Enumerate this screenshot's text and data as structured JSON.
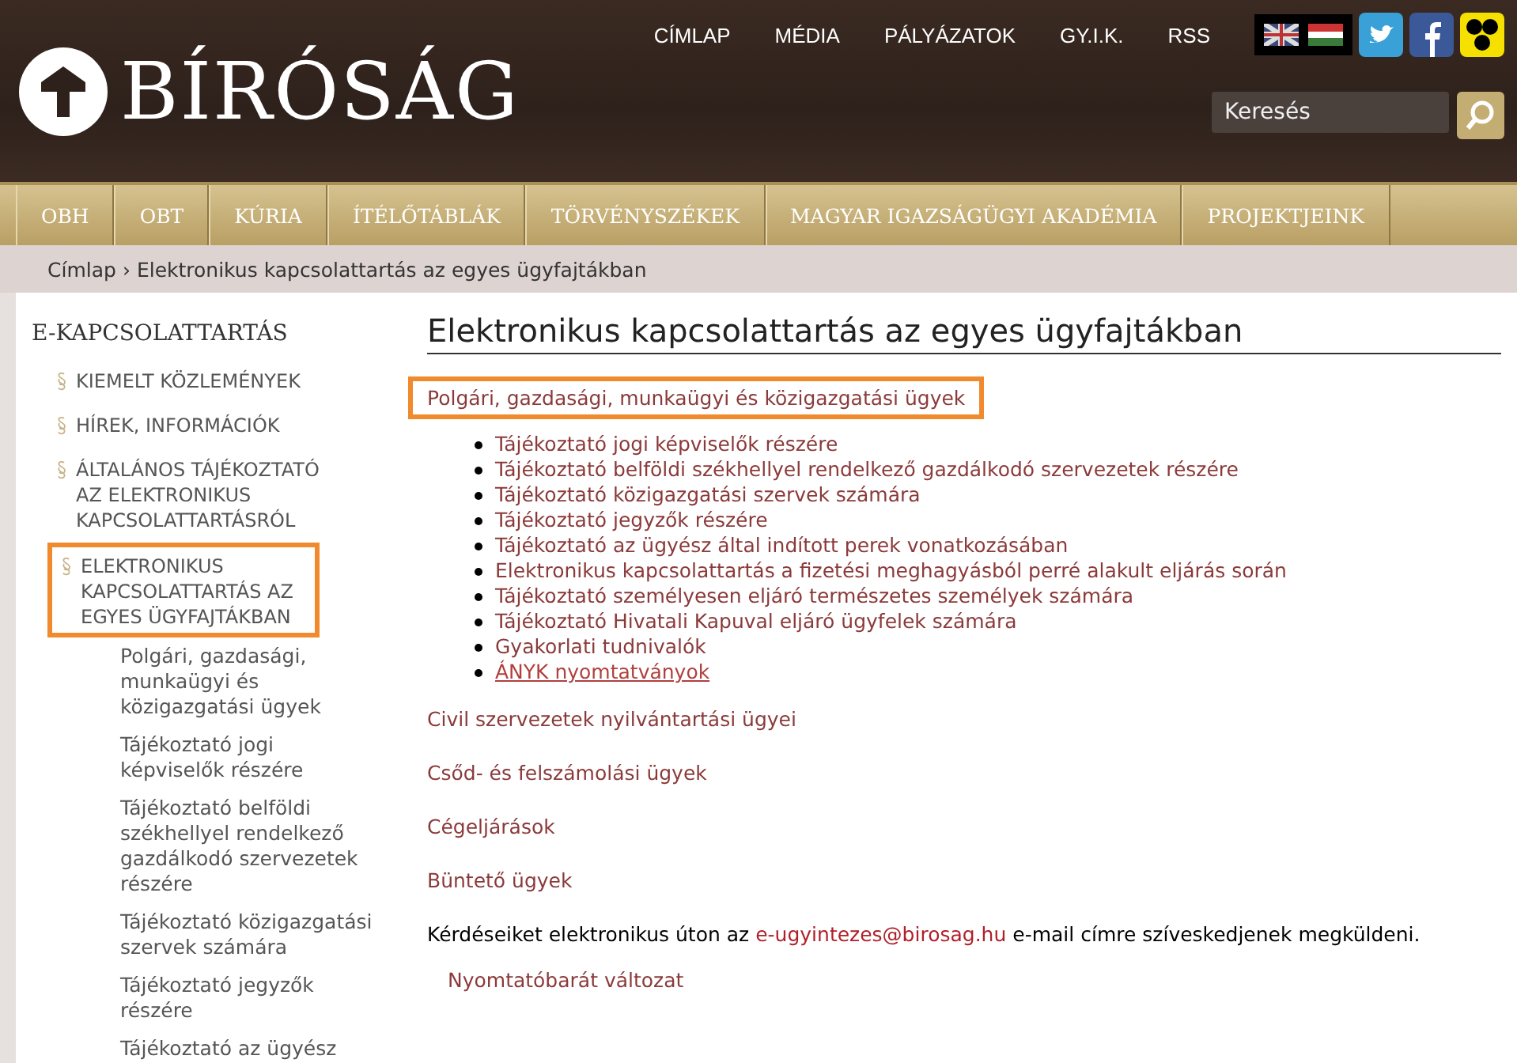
{
  "header": {
    "logo_text": "BÍRÓSÁG",
    "top_links": [
      "CÍMLAP",
      "MÉDIA",
      "PÁLYÁZATOK",
      "GY.I.K.",
      "RSS"
    ],
    "search": {
      "placeholder": "Keresés"
    }
  },
  "nav": [
    "OBH",
    "OBT",
    "KÚRIA",
    "ÍTÉLŐTÁBLÁK",
    "TÖRVÉNYSZÉKEK",
    "MAGYAR IGAZSÁGÜGYI AKADÉMIA",
    "PROJEKTJEINK"
  ],
  "breadcrumb": {
    "home": "Címlap",
    "separator": "›",
    "current": "Elektronikus kapcsolattartás az egyes ügyfajtákban"
  },
  "sidebar": {
    "title": "E-KAPCSOLATTARTÁS",
    "items": [
      {
        "label": "KIEMELT KÖZLEMÉNYEK",
        "highlighted": false
      },
      {
        "label": "HÍREK, INFORMÁCIÓK",
        "highlighted": false
      },
      {
        "label": "ÁLTALÁNOS TÁJÉKOZTATÓ AZ ELEKTRONIKUS KAPCSOLATTARTÁSRÓL",
        "highlighted": false
      },
      {
        "label": "ELEKTRONIKUS KAPCSOLATTARTÁS AZ EGYES ÜGYFAJTÁKBAN",
        "highlighted": true,
        "children": [
          {
            "label": "Polgári, gazdasági, munkaügyi és közigazgatási ügyek"
          },
          {
            "label": "Tájékoztató jogi képviselők részére"
          },
          {
            "label": "Tájékoztató belföldi székhellyel rendelkező gazdálkodó szervezetek részére"
          },
          {
            "label": "Tájékoztató közigazgatási szervek számára"
          },
          {
            "label": "Tájékoztató jegyzők részére"
          },
          {
            "label": "Tájékoztató az ügyész"
          }
        ]
      }
    ]
  },
  "main": {
    "title": "Elektronikus kapcsolattartás az egyes ügyfajtákban",
    "sections": [
      {
        "label": "Polgári, gazdasági, munkaügyi és közigazgatási ügyek",
        "highlighted": true,
        "items": [
          {
            "label": "Tájékoztató jogi képviselők részére",
            "underlined": false
          },
          {
            "label": "Tájékoztató belföldi székhellyel rendelkező gazdálkodó szervezetek részére",
            "underlined": false
          },
          {
            "label": "Tájékoztató közigazgatási szervek számára",
            "underlined": false
          },
          {
            "label": "Tájékoztató jegyzők részére",
            "underlined": false
          },
          {
            "label": "Tájékoztató az ügyész által indított perek vonatkozásában",
            "underlined": false
          },
          {
            "label": "Elektronikus kapcsolattartás a fizetési meghagyásból perré alakult eljárás során",
            "underlined": false
          },
          {
            "label": "Tájékoztató személyesen eljáró természetes személyek számára",
            "underlined": false
          },
          {
            "label": "Tájékoztató Hivatali Kapuval eljáró ügyfelek számára",
            "underlined": false
          },
          {
            "label": "Gyakorlati tudnivalók",
            "underlined": false
          },
          {
            "label": "ÁNYK nyomtatványok",
            "underlined": true
          }
        ]
      },
      {
        "label": "Civil szervezetek nyilvántartási ügyei",
        "highlighted": false
      },
      {
        "label": "Csőd- és felszámolási ügyek",
        "highlighted": false
      },
      {
        "label": "Cégeljárások",
        "highlighted": false
      },
      {
        "label": "Büntető ügyek",
        "highlighted": false
      }
    ],
    "contact": {
      "before": "Kérdéseiket elektronikus úton az",
      "email": "e-ugyintezes@birosag.hu",
      "after": "e-mail címre szíveskedjenek megküldeni."
    },
    "print_link": "Nyomtatóbarát változat"
  }
}
